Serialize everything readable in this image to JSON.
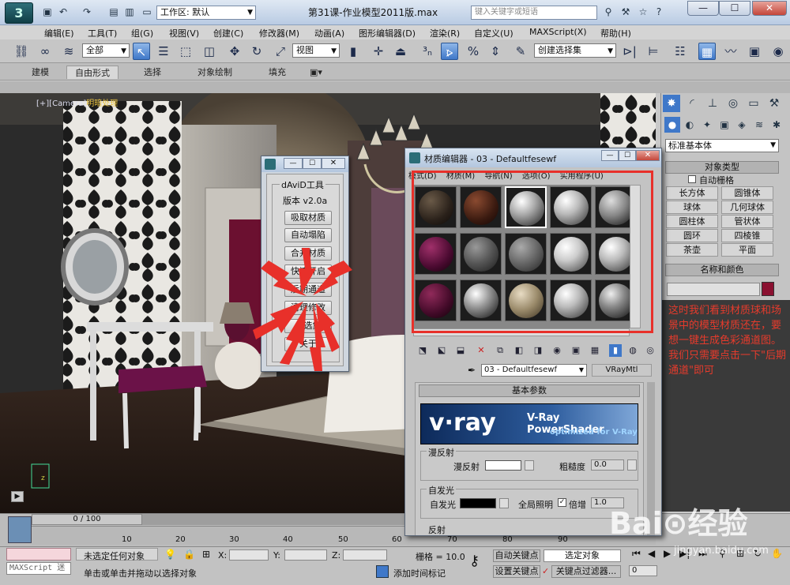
{
  "window": {
    "title": "第31课-作业模型2011版.max",
    "workspace": "工作区: 默认",
    "search_placeholder": "键入关键字或短语",
    "controls": {
      "minimize": "—",
      "maximize": "☐",
      "close": "✕"
    }
  },
  "menubar": [
    "编辑(E)",
    "工具(T)",
    "组(G)",
    "视图(V)",
    "创建(C)",
    "修改器(M)",
    "动画(A)",
    "图形编辑器(D)",
    "渲染(R)",
    "自定义(U)",
    "MAXScript(X)",
    "帮助(H)"
  ],
  "toolbar": {
    "selection_filter": "全部",
    "ref_coord": "视图",
    "named_selection": "创建选择集"
  },
  "ribbon_tabs": [
    "建模",
    "自由形式",
    "选择",
    "对象绘制",
    "填充"
  ],
  "viewport": {
    "label_prefix": "[+][",
    "label_camera": "Camera",
    "label_suffix": "]",
    "label_mode": "明暗处理"
  },
  "command_panel": {
    "category": "标准基本体",
    "rollout_object_type": "对象类型",
    "autogrid": "自动栅格",
    "objects": [
      "长方体",
      "圆锥体",
      "球体",
      "几何球体",
      "圆柱体",
      "管状体",
      "圆环",
      "四棱锥",
      "茶壶",
      "平面"
    ],
    "rollout_name_color": "名称和颜色",
    "accent_color": "#8a1030"
  },
  "annotation": {
    "text": "这时我们看到材质球和场景中的模型材质还在，要想一键生成色彩通道图。我们只需要点击一下\"后期通道\"即可",
    "color": "#e53b2c"
  },
  "david_tool": {
    "group_title": "dAviD工具",
    "version": "版本 v2.0a",
    "buttons": [
      "吸取材质",
      "自动塌陷",
      "合并材质",
      "快速开启",
      "后期通道",
      "清理修改",
      "组选集",
      "关于"
    ]
  },
  "material_editor": {
    "title": "材质编辑器 - 03 - Defaultfesewf",
    "menu": [
      "模式(D)",
      "材质(M)",
      "导航(N)",
      "选项(O)",
      "实用程序(U)"
    ],
    "material_name": "03 - Defaultfesewf",
    "material_type": "VRayMtl",
    "rollout_basic": "基本参数",
    "banner": {
      "logo": "v·ray",
      "title": "V-Ray PowerShader",
      "subtitle": "optimized for V-Ray"
    },
    "diffuse_group": "漫反射",
    "diffuse_label": "漫反射",
    "roughness_label": "粗糙度",
    "roughness_value": "0.0",
    "self_illum_group": "自发光",
    "self_illum_label": "自发光",
    "gi_label": "全局照明",
    "multiplier_label": "倍增",
    "multiplier_value": "1.0",
    "reflection_group": "反射",
    "frame_color": "#e8302a"
  },
  "timeline": {
    "slider": "0 / 100",
    "ticks": [
      "10",
      "20",
      "30",
      "40",
      "50",
      "60",
      "70",
      "80",
      "90"
    ]
  },
  "statusbar": {
    "maxscript_placeholder": "MAXScript 迷",
    "selection_status": "未选定任何对象",
    "prompt": "单击或单击并拖动以选择对象",
    "x_label": "X:",
    "y_label": "Y:",
    "z_label": "Z:",
    "grid": "栅格 = 10.0",
    "auto_key": "自动关键点",
    "set_key": "设置关键点",
    "key_mode": "选定对象",
    "key_filters": "关键点过滤器...",
    "add_time_tag": "添加时间标记",
    "frame": "0"
  },
  "watermark": {
    "brand": "Bai⊙经验",
    "url": "jingyan.baidu.com"
  }
}
